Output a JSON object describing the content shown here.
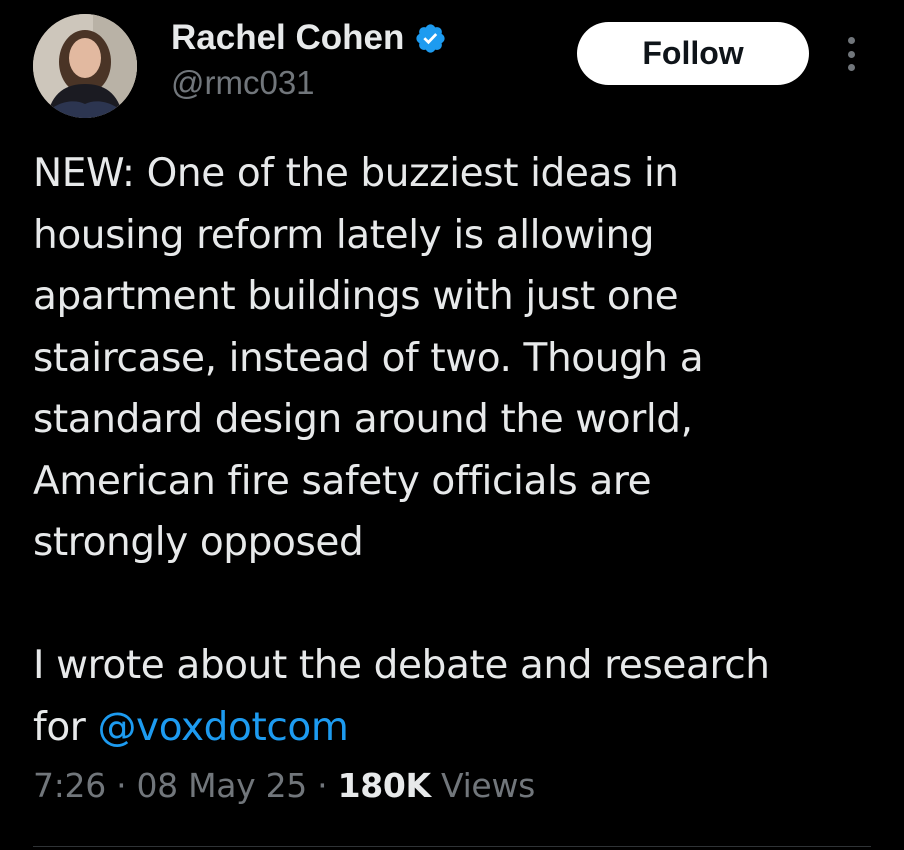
{
  "author": {
    "display_name": "Rachel Cohen",
    "handle": "@rmc031",
    "verified_icon": "verified-badge-icon",
    "avatar_icon": "profile-photo"
  },
  "actions": {
    "follow_label": "Follow",
    "more_icon": "more-vertical-icon"
  },
  "tweet": {
    "lines_p1": [
      "NEW: One of the buzziest ideas in",
      "housing reform lately is allowing",
      "apartment buildings with just one",
      "staircase, instead of two. Though a",
      "standard design around the world,",
      "American fire safety officials are",
      "strongly opposed"
    ],
    "line_p2_1": "I wrote about the debate and research",
    "line_p2_2_prefix": "for ",
    "mention": "@voxdotcom"
  },
  "meta": {
    "time": "7:26",
    "separator": " · ",
    "date": "08 May 25",
    "views_count": "180K",
    "views_label": " Views"
  },
  "colors": {
    "background": "#000000",
    "text": "#e7e9ea",
    "secondary": "#71767b",
    "accent": "#1d9bf0",
    "follow_bg": "#ffffff"
  }
}
